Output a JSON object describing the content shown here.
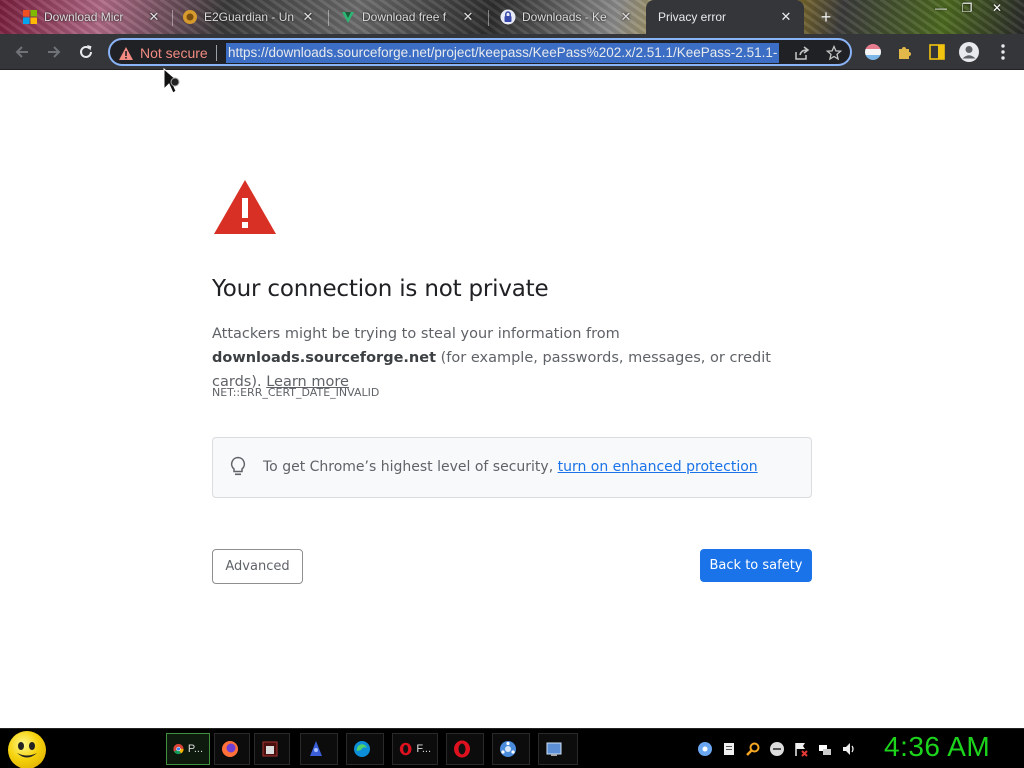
{
  "browser": {
    "tabs": [
      {
        "title": "Download Micr",
        "close": "✕",
        "favicon": "windows-logo"
      },
      {
        "title": "E2Guardian - Un",
        "close": "✕",
        "favicon": "e2guardian-logo"
      },
      {
        "title": "Download free f",
        "close": "✕",
        "favicon": "download-logo"
      },
      {
        "title": "Downloads - Ke",
        "close": "✕",
        "favicon": "keepass-logo"
      },
      {
        "title": "Privacy error",
        "close": "✕",
        "favicon": "none",
        "active": true
      }
    ],
    "new_tab_label": "+",
    "window_controls": {
      "minimize": "—",
      "maximize": "❐",
      "close": "✕"
    },
    "security_chip_label": "Not secure",
    "url": "https://downloads.sourceforge.net/project/keepass/KeePass%202.x/2.51.1/KeePass-2.51.1-"
  },
  "page": {
    "heading": "Your connection is not private",
    "explain_prefix": "Attackers might be trying to steal your information from ",
    "explain_host": "downloads.sourceforge.net",
    "explain_suffix": " (for example, passwords, messages, or credit cards). ",
    "learn_more": "Learn more",
    "error_code": "NET::ERR_CERT_DATE_INVALID",
    "tip_prefix": "To get Chrome’s highest level of security, ",
    "tip_link": "turn on enhanced protection",
    "advanced_button": "Advanced",
    "back_button": "Back to safety"
  },
  "taskbar": {
    "apps": [
      {
        "label": "P...",
        "icon": "chrome-icon",
        "active": true
      },
      {
        "label": "",
        "icon": "firefox-icon"
      },
      {
        "label": "",
        "icon": "terminal-icon"
      },
      {
        "label": "",
        "icon": "wizard-icon"
      },
      {
        "label": "",
        "icon": "edge-icon"
      },
      {
        "label": "F...",
        "icon": "opera-icon"
      },
      {
        "label": "",
        "icon": "opera-icon"
      },
      {
        "label": "",
        "icon": "network-icon"
      },
      {
        "label": "",
        "icon": "control-panel-icon"
      }
    ],
    "clock": "4:36 AM"
  },
  "colors": {
    "accent": "#1a73e8",
    "danger": "#d93025",
    "not_secure": "#f28b82",
    "clock": "#1cd41c"
  }
}
